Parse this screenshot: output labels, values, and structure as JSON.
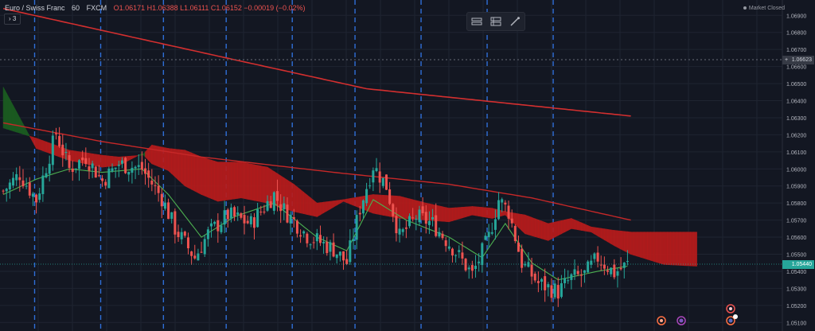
{
  "symbol": {
    "name": "Euro / Swiss Franc",
    "interval": "60",
    "exchange": "FXCM",
    "ohlc": "O1.06171  H1.06388  L1.06111  C1.06152  −0.00019 (−0.02%)"
  },
  "collapse_label": "› 3",
  "market_status": "Market Closed",
  "crosshair_price": "1.06623",
  "last_price": "1.05440",
  "colors": {
    "background": "#131722",
    "grid": "#1f2431",
    "up": "#26a69a",
    "down": "#ef5350",
    "cloud_bear": "#b71c1c",
    "cloud_bull": "#1b5e20",
    "ma_long": "#d32f2f",
    "ma_mid": "#c62828",
    "tenkan": "#4caf50",
    "session_lines": "#2f6fd8"
  },
  "toolbar_icons": [
    "ruler-horizontal-icon",
    "ruler-vertical-icon",
    "brush-icon"
  ],
  "chart_data": {
    "type": "candlestick",
    "y_axis": {
      "range": [
        1.0505,
        1.0699
      ],
      "tick_labels": [
        "1.06900",
        "1.06800",
        "1.06700",
        "1.06600",
        "1.06500",
        "1.06400",
        "1.06300",
        "1.06200",
        "1.06100",
        "1.06000",
        "1.05900",
        "1.05800",
        "1.05700",
        "1.05600",
        "1.05500",
        "1.05400",
        "1.05300",
        "1.05200",
        "1.05100"
      ],
      "position": "right"
    },
    "candle_count": 190,
    "session_breaks_at_candle": [
      10,
      30,
      49,
      68,
      88,
      107,
      127,
      147,
      167
    ],
    "close_path": [
      [
        0,
        1.0587
      ],
      [
        5,
        1.0597
      ],
      [
        10,
        1.0582
      ],
      [
        16,
        1.0621
      ],
      [
        20,
        1.06
      ],
      [
        25,
        1.0607
      ],
      [
        30,
        1.0593
      ],
      [
        35,
        1.0603
      ],
      [
        42,
        1.06
      ],
      [
        48,
        1.0583
      ],
      [
        52,
        1.0565
      ],
      [
        58,
        1.0548
      ],
      [
        62,
        1.0562
      ],
      [
        68,
        1.0573
      ],
      [
        75,
        1.0568
      ],
      [
        82,
        1.0585
      ],
      [
        85,
        1.0576
      ],
      [
        92,
        1.0561
      ],
      [
        100,
        1.0553
      ],
      [
        104,
        1.0545
      ],
      [
        108,
        1.0577
      ],
      [
        112,
        1.0602
      ],
      [
        116,
        1.059
      ],
      [
        120,
        1.056
      ],
      [
        125,
        1.0572
      ],
      [
        130,
        1.0568
      ],
      [
        136,
        1.0554
      ],
      [
        142,
        1.0538
      ],
      [
        147,
        1.056
      ],
      [
        150,
        1.0582
      ],
      [
        153,
        1.0575
      ],
      [
        157,
        1.0545
      ],
      [
        162,
        1.0533
      ],
      [
        168,
        1.0528
      ],
      [
        172,
        1.0536
      ],
      [
        176,
        1.0538
      ],
      [
        180,
        1.0548
      ],
      [
        185,
        1.0539
      ],
      [
        189,
        1.0544
      ]
    ],
    "ma_long": [
      [
        0,
        1.0694
      ],
      [
        70,
        1.0664
      ],
      [
        110,
        1.0647
      ],
      [
        190,
        1.0631
      ]
    ],
    "ma_mid": [
      [
        0,
        1.0627
      ],
      [
        30,
        1.0616
      ],
      [
        60,
        1.0607
      ],
      [
        100,
        1.0598
      ],
      [
        135,
        1.0591
      ],
      [
        160,
        1.0583
      ],
      [
        190,
        1.057
      ]
    ],
    "tenkan": [
      [
        0,
        1.0585
      ],
      [
        10,
        1.0594
      ],
      [
        20,
        1.06
      ],
      [
        30,
        1.0598
      ],
      [
        42,
        1.06
      ],
      [
        50,
        1.0585
      ],
      [
        60,
        1.056
      ],
      [
        70,
        1.0572
      ],
      [
        82,
        1.058
      ],
      [
        95,
        1.056
      ],
      [
        104,
        1.0552
      ],
      [
        112,
        1.0582
      ],
      [
        122,
        1.057
      ],
      [
        135,
        1.056
      ],
      [
        145,
        1.0548
      ],
      [
        152,
        1.0568
      ],
      [
        160,
        1.0545
      ],
      [
        168,
        1.0535
      ],
      [
        180,
        1.054
      ],
      [
        189,
        1.0543
      ]
    ],
    "cloud_top": [
      [
        0,
        1.0624
      ],
      [
        10,
        1.0618
      ],
      [
        20,
        1.0611
      ],
      [
        30,
        1.0608
      ],
      [
        35,
        1.0607
      ],
      [
        42,
        1.0608
      ],
      [
        45,
        1.0614
      ],
      [
        50,
        1.0612
      ],
      [
        55,
        1.0611
      ],
      [
        60,
        1.0607
      ],
      [
        65,
        1.0604
      ],
      [
        72,
        1.0604
      ],
      [
        80,
        1.0601
      ],
      [
        88,
        1.0591
      ],
      [
        95,
        1.058
      ],
      [
        103,
        1.0582
      ],
      [
        112,
        1.0585
      ],
      [
        120,
        1.0584
      ],
      [
        128,
        1.058
      ],
      [
        135,
        1.0577
      ],
      [
        142,
        1.0578
      ],
      [
        148,
        1.0577
      ],
      [
        152,
        1.0575
      ],
      [
        158,
        1.0573
      ],
      [
        165,
        1.0568
      ],
      [
        172,
        1.0571
      ],
      [
        178,
        1.0566
      ],
      [
        185,
        1.0564
      ],
      [
        190,
        1.0563
      ],
      [
        200,
        1.0563
      ],
      [
        210,
        1.0563
      ]
    ],
    "cloud_bottom": [
      [
        0,
        1.0648
      ],
      [
        10,
        1.0612
      ],
      [
        20,
        1.0605
      ],
      [
        30,
        1.0601
      ],
      [
        35,
        1.0602
      ],
      [
        42,
        1.0609
      ],
      [
        45,
        1.0603
      ],
      [
        50,
        1.0599
      ],
      [
        55,
        1.059
      ],
      [
        60,
        1.0585
      ],
      [
        65,
        1.0581
      ],
      [
        72,
        1.0583
      ],
      [
        80,
        1.058
      ],
      [
        88,
        1.0575
      ],
      [
        95,
        1.0572
      ],
      [
        103,
        1.0581
      ],
      [
        112,
        1.0574
      ],
      [
        120,
        1.0571
      ],
      [
        128,
        1.057
      ],
      [
        135,
        1.0569
      ],
      [
        142,
        1.0573
      ],
      [
        148,
        1.0571
      ],
      [
        152,
        1.0573
      ],
      [
        158,
        1.0562
      ],
      [
        165,
        1.0558
      ],
      [
        172,
        1.0565
      ],
      [
        178,
        1.0563
      ],
      [
        185,
        1.0555
      ],
      [
        190,
        1.055
      ],
      [
        200,
        1.0544
      ],
      [
        210,
        1.0543
      ]
    ]
  }
}
